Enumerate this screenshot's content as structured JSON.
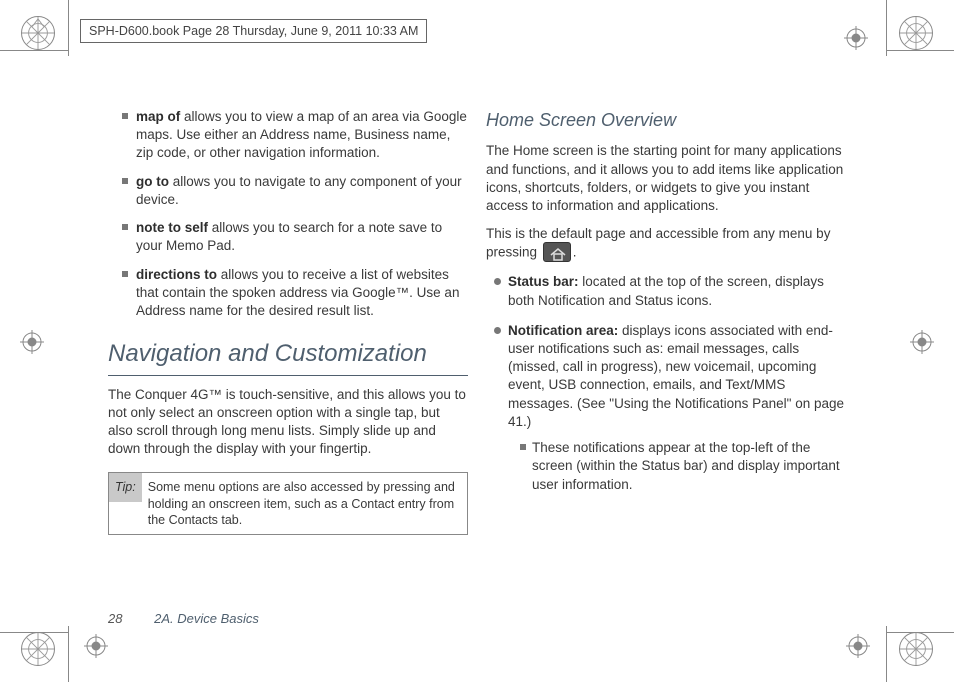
{
  "header": {
    "text": "SPH-D600.book  Page 28  Thursday, June 9, 2011  10:33 AM"
  },
  "left_col": {
    "voice_cmds": [
      {
        "term": "map of",
        "desc": " allows you to view a map of an area via Google maps. Use either an Address name, Business name, zip code, or other navigation information."
      },
      {
        "term": "go to",
        "desc": " allows you to navigate to any component of your device."
      },
      {
        "term": "note to self",
        "desc": " allows you to search for a note save to your Memo Pad."
      },
      {
        "term": "directions to",
        "desc": " allows you to receive a list of websites that contain the spoken address via Google™. Use an Address name for the desired result list."
      }
    ],
    "section_title": "Navigation and Customization",
    "section_body": "The Conquer 4G™ is touch-sensitive, and this allows you to not only select an onscreen option with a single tap, but also scroll through long menu lists. Simply slide up and down through the display with your fingertip.",
    "tip_label": "Tip:",
    "tip_body": "Some menu options are also accessed by pressing and holding an onscreen item, such as a Contact entry from the Contacts tab."
  },
  "right_col": {
    "subsection_title": "Home Screen Overview",
    "p1": "The Home screen is the starting point for many applications and functions, and it allows you to add items like application icons, shortcuts, folders, or widgets to give you instant access to information and applications.",
    "p2_pre": "This is the default page and accessible from any menu by pressing ",
    "p2_post": ".",
    "bullets": [
      {
        "term": "Status bar:",
        "desc": " located at the top of the screen, displays both Notification and Status icons."
      },
      {
        "term": "Notification area:",
        "desc": " displays icons associated with end-user notifications such as: email messages, calls (missed, call in progress), new voicemail, upcoming event, USB connection, emails, and Text/MMS messages. (See \"Using the Notifications Panel\" on page 41.)",
        "sub": "These notifications appear at the top-left of the screen (within the Status bar) and display important user information."
      }
    ]
  },
  "footer": {
    "page_no": "28",
    "section": "2A. Device Basics"
  }
}
